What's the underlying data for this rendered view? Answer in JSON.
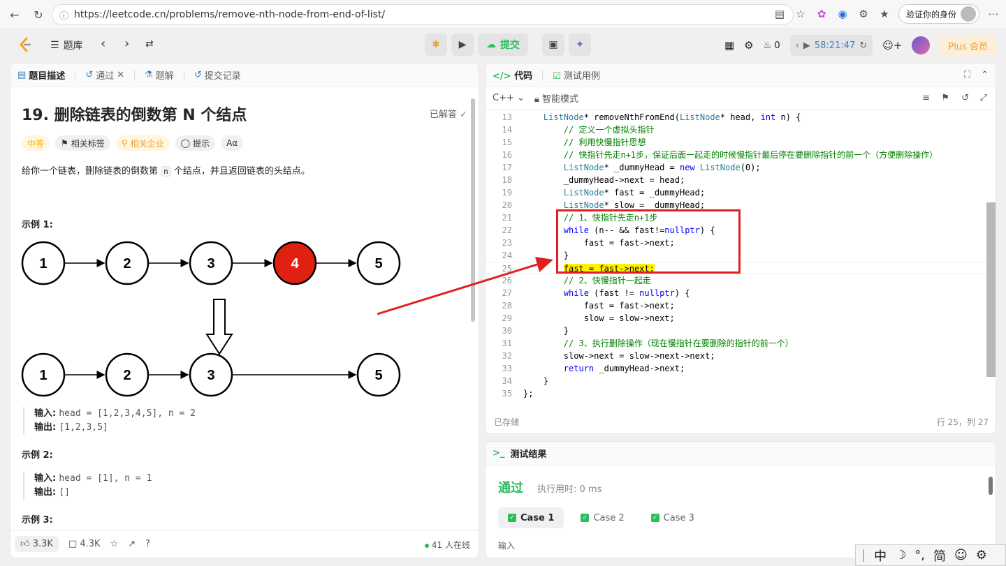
{
  "browser": {
    "url": "https://leetcode.cn/problems/remove-nth-node-from-end-of-list/",
    "verify_label": "验证你的身份"
  },
  "app": {
    "problem_bank": "题库",
    "submit_label": "提交",
    "streak_count": "0",
    "timer": "58:21:47",
    "plus_label": "Plus 会员"
  },
  "left_tabs": [
    {
      "label": "题目描述"
    },
    {
      "label": "通过"
    },
    {
      "label": "题解"
    },
    {
      "label": "提交记录"
    }
  ],
  "problem": {
    "title": "19. 删除链表的倒数第 N 个结点",
    "solved_label": "已解答",
    "difficulty": "中等",
    "tags_label": "相关标签",
    "company_label": "相关企业",
    "hint_label": "提示",
    "desc_before": "给你一个链表，删除链表的倒数第",
    "desc_code": "n",
    "desc_after": "个结点，并且返回链表的头结点。",
    "example1_title": "示例 1:",
    "example1_input_label": "输入:",
    "example1_input": "head = [1,2,3,4,5], n = 2",
    "example1_output_label": "输出:",
    "example1_output": "[1,2,3,5]",
    "example2_title": "示例 2:",
    "example2_input_label": "输入:",
    "example2_input": "head = [1], n = 1",
    "example2_output_label": "输出:",
    "example2_output": "[]",
    "example3_title": "示例 3:",
    "list_before": [
      "1",
      "2",
      "3",
      "4",
      "5"
    ],
    "list_after": [
      "1",
      "2",
      "3",
      "5"
    ],
    "removed_node": "4"
  },
  "left_footer": {
    "likes": "3.3K",
    "comments": "4.3K",
    "online": "41 人在线"
  },
  "code_panel": {
    "tab_code": "代码",
    "tab_testcase": "测试用例",
    "language": "C++",
    "mode": "智能模式",
    "saved": "已存储",
    "cursor": "行 25，列 27",
    "lines": [
      {
        "n": "13",
        "text": "    ListNode* removeNthFromEnd(ListNode* head, int n) {"
      },
      {
        "n": "14",
        "text": "        // 定义一个虚拟头指针"
      },
      {
        "n": "15",
        "text": "        // 利用快慢指针思想"
      },
      {
        "n": "16",
        "text": "        // 快指针先走n+1步，保证后面一起走的时候慢指针最后停在要删除指针的前一个（方便删除操作）"
      },
      {
        "n": "17",
        "text": "        ListNode* _dummyHead = new ListNode(0);"
      },
      {
        "n": "18",
        "text": "        _dummyHead->next = head;"
      },
      {
        "n": "19",
        "text": "        ListNode* fast = _dummyHead;"
      },
      {
        "n": "20",
        "text": "        ListNode* slow = _dummyHead;"
      },
      {
        "n": "21",
        "text": "        // 1、快指针先走n+1步"
      },
      {
        "n": "22",
        "text": "        while (n-- && fast!=nullptr) {"
      },
      {
        "n": "23",
        "text": "            fast = fast->next;"
      },
      {
        "n": "24",
        "text": "        }"
      },
      {
        "n": "25",
        "text": "        fast = fast->next;"
      },
      {
        "n": "26",
        "text": "        // 2、快慢指针一起走"
      },
      {
        "n": "27",
        "text": "        while (fast != nullptr) {"
      },
      {
        "n": "28",
        "text": "            fast = fast->next;"
      },
      {
        "n": "29",
        "text": "            slow = slow->next;"
      },
      {
        "n": "30",
        "text": "        }"
      },
      {
        "n": "31",
        "text": "        // 3、执行删除操作（现在慢指针在要删除的指针的前一个）"
      },
      {
        "n": "32",
        "text": "        slow->next = slow->next->next;"
      },
      {
        "n": "33",
        "text": "        return _dummyHead->next;"
      },
      {
        "n": "34",
        "text": "    }"
      },
      {
        "n": "35",
        "text": "};"
      }
    ]
  },
  "result": {
    "title": "测试结果",
    "status": "通过",
    "runtime": "执行用时: 0 ms",
    "cases": [
      "Case 1",
      "Case 2",
      "Case 3"
    ],
    "input_label": "输入"
  },
  "ime": {
    "lang": "中",
    "punct": "°,",
    "mode": "简"
  }
}
